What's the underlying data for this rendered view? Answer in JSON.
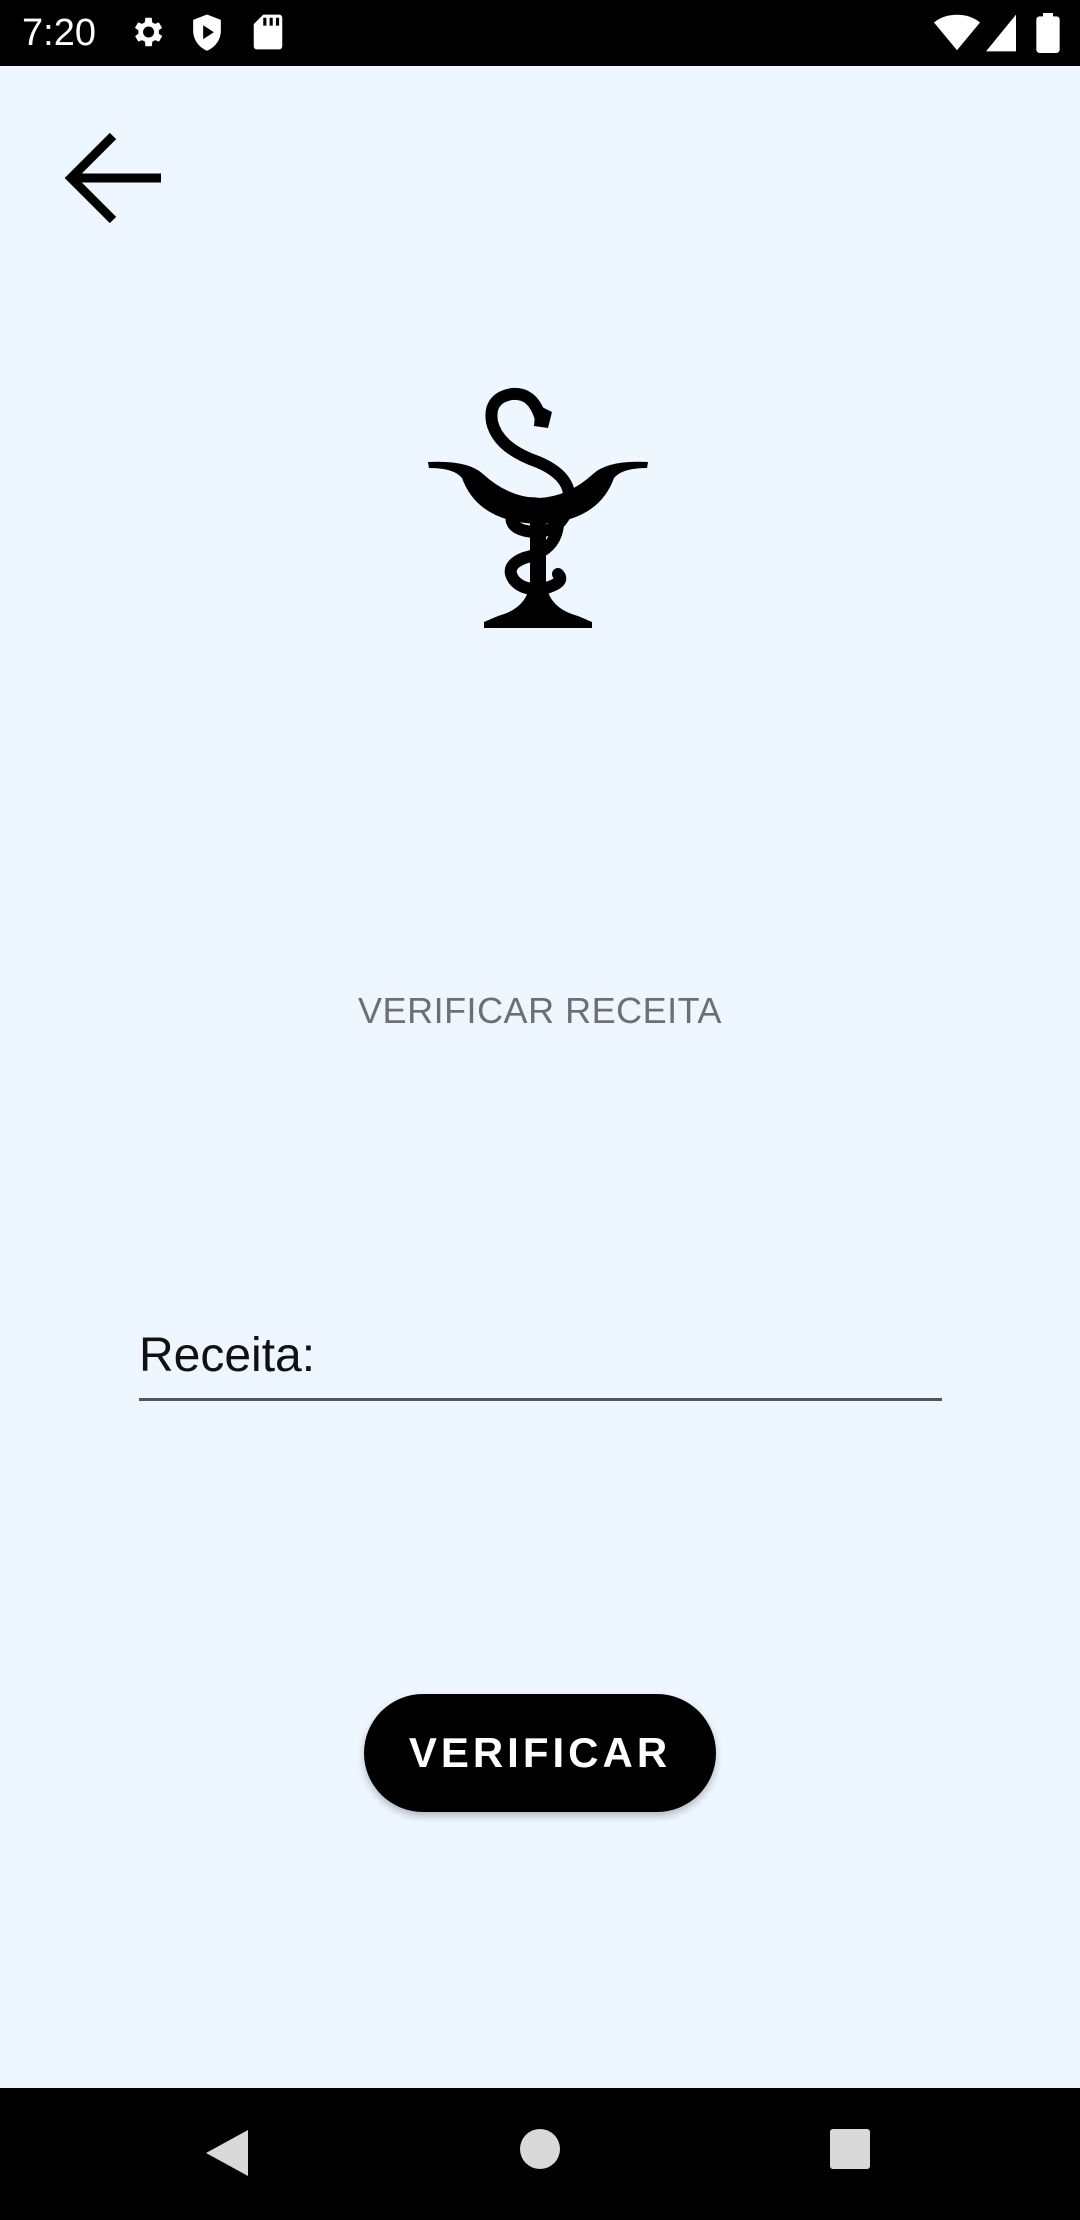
{
  "status_bar": {
    "time": "7:20",
    "icons_left": [
      "settings-icon",
      "shield-play-icon",
      "sd-card-icon"
    ],
    "icons_right": [
      "wifi-icon",
      "cell-signal-icon",
      "battery-icon"
    ]
  },
  "toolbar": {
    "back_icon": "arrow-left-icon"
  },
  "logo": {
    "icon": "pharmacy-bowl-of-hygieia-icon"
  },
  "screen": {
    "title": "VERIFICAR RECEITA"
  },
  "form": {
    "receita_label": "Receita:",
    "receita_value": ""
  },
  "actions": {
    "verify_label": "VERIFICAR"
  },
  "nav_bar": {
    "back": "nav-back-icon",
    "home": "nav-home-icon",
    "recents": "nav-recents-icon"
  },
  "colors": {
    "background": "#eef6ff",
    "button": "#000000",
    "title_text": "#6f6f6f"
  }
}
